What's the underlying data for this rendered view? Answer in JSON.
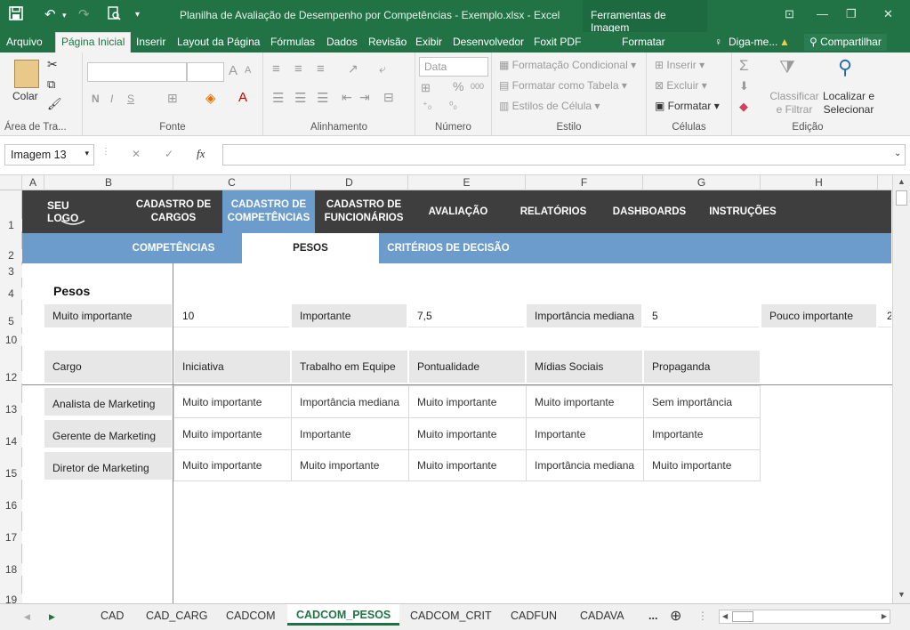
{
  "window": {
    "title": "Planilha de Avaliação de Desempenho por Competências - Exemplo.xlsx - Excel",
    "tools_label": "Ferramentas de Imagem"
  },
  "menu": {
    "tabs": [
      "Arquivo",
      "Página Inicial",
      "Inserir",
      "Layout da Página",
      "Fórmulas",
      "Dados",
      "Revisão",
      "Exibir",
      "Desenvolvedor",
      "Foxit PDF",
      "Formatar",
      "Diga-me...",
      "Compartilhar"
    ]
  },
  "ribbon": {
    "clipboard": {
      "paste": "Colar",
      "label": "Área de Tra..."
    },
    "font": {
      "bold": "N",
      "italic": "I",
      "underline": "S",
      "grow": "A",
      "shrink": "A",
      "label": "Fonte"
    },
    "alignment": {
      "label": "Alinhamento"
    },
    "number": {
      "format": "Data",
      "percent": "%",
      "thousands": "000",
      "label": "Número"
    },
    "styles": {
      "conditional": "Formatação Condicional",
      "table": "Formatar como Tabela",
      "cell": "Estilos de Célula",
      "label": "Estilo"
    },
    "cells": {
      "insert": "Inserir",
      "delete": "Excluir",
      "format": "Formatar",
      "label": "Células"
    },
    "editing": {
      "sort": "Classificar e Filtrar",
      "find": "Localizar e Selecionar",
      "label": "Edição"
    }
  },
  "formula_bar": {
    "name_box": "Imagem 13",
    "fx": "fx",
    "cancel": "✕",
    "enter": "✓",
    "value": ""
  },
  "columns": [
    "A",
    "B",
    "C",
    "D",
    "E",
    "F",
    "G",
    "H"
  ],
  "rows": [
    "1",
    "2",
    "3",
    "4",
    "5",
    "10",
    "12",
    "13",
    "14",
    "15",
    "16",
    "17",
    "18",
    "19"
  ],
  "nav": {
    "logo": "SEU LOGO",
    "items": [
      "CADASTRO DE CARGOS",
      "CADASTRO DE COMPETÊNCIAS",
      "CADASTRO DE FUNCIONÁRIOS",
      "AVALIAÇÃO",
      "RELATÓRIOS",
      "DASHBOARDS",
      "INSTRUÇÕES"
    ]
  },
  "subnav": {
    "items": [
      "COMPETÊNCIAS",
      "PESOS",
      "CRITÉRIOS DE DECISÃO"
    ]
  },
  "weights": {
    "title": "Pesos",
    "items": [
      {
        "label": "Muito importante",
        "value": "10"
      },
      {
        "label": "Importante",
        "value": "7,5"
      },
      {
        "label": "Importância mediana",
        "value": "5"
      },
      {
        "label": "Pouco importante",
        "value": "2"
      }
    ]
  },
  "table": {
    "headers": [
      "Cargo",
      "Iniciativa",
      "Trabalho em Equipe",
      "Pontualidade",
      "Mídias Sociais",
      "Propaganda"
    ],
    "rows": [
      [
        "Analista de Marketing",
        "Muito importante",
        "Importância mediana",
        "Muito importante",
        "Muito importante",
        "Sem importância"
      ],
      [
        "Gerente de Marketing",
        "Muito importante",
        "Importante",
        "Muito importante",
        "Importante",
        "Importante"
      ],
      [
        "Diretor de Marketing",
        "Muito importante",
        "Muito importante",
        "Muito importante",
        "Importância mediana",
        "Muito importante"
      ]
    ]
  },
  "sheets": {
    "items": [
      "CAD",
      "CAD_CARG",
      "CADCOM",
      "CADCOM_PESOS",
      "CADCOM_CRIT",
      "CADFUN",
      "CADAVA",
      "..."
    ]
  },
  "colors": {
    "excel_green": "#217346",
    "nav_dark": "#3e3e3e",
    "nav_active": "#6c9ccc",
    "subnav": "#6c9ccc"
  }
}
